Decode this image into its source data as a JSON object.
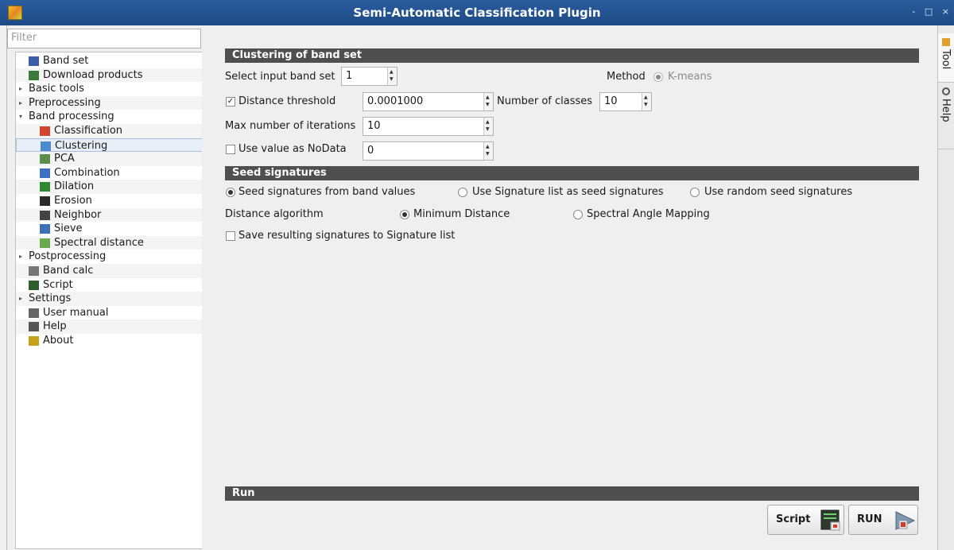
{
  "window": {
    "title": "Semi-Automatic Classification Plugin",
    "controls": "- □ ×"
  },
  "sidebar": {
    "filter_placeholder": "Filter",
    "items": [
      {
        "label": "Band set",
        "level": 0,
        "icon": "band-set-icon",
        "icon_color": "#3a5fa8"
      },
      {
        "label": "Download products",
        "level": 0,
        "icon": "download-icon",
        "icon_color": "#3c7a3a"
      },
      {
        "label": "Basic tools",
        "level": 0,
        "arrow": "▸"
      },
      {
        "label": "Preprocessing",
        "level": 0,
        "arrow": "▸"
      },
      {
        "label": "Band processing",
        "level": 0,
        "arrow": "▾"
      },
      {
        "label": "Classification",
        "level": 1,
        "icon": "classification-icon",
        "icon_color": "#d1442e"
      },
      {
        "label": "Clustering",
        "level": 1,
        "icon": "clustering-icon",
        "icon_color": "#4a8ad0",
        "selected": true
      },
      {
        "label": "PCA",
        "level": 1,
        "icon": "pca-icon",
        "icon_color": "#5a8f4a"
      },
      {
        "label": "Combination",
        "level": 1,
        "icon": "combination-icon",
        "icon_color": "#3e6fc0"
      },
      {
        "label": "Dilation",
        "level": 1,
        "icon": "dilation-icon",
        "icon_color": "#2f8a2f"
      },
      {
        "label": "Erosion",
        "level": 1,
        "icon": "erosion-icon",
        "icon_color": "#2a2a2a"
      },
      {
        "label": "Neighbor",
        "level": 1,
        "icon": "neighbor-icon",
        "icon_color": "#444444"
      },
      {
        "label": "Sieve",
        "level": 1,
        "icon": "sieve-icon",
        "icon_color": "#3d6fb8"
      },
      {
        "label": "Spectral distance",
        "level": 1,
        "icon": "spectral-distance-icon",
        "icon_color": "#6aa84f"
      },
      {
        "label": "Postprocessing",
        "level": 0,
        "arrow": "▸"
      },
      {
        "label": "Band calc",
        "level": 0,
        "icon": "band-calc-icon",
        "icon_color": "#777777"
      },
      {
        "label": "Script",
        "level": 0,
        "icon": "script-icon",
        "icon_color": "#2e5d2e"
      },
      {
        "label": "Settings",
        "level": 0,
        "arrow": "▸"
      },
      {
        "label": "User manual",
        "level": 0,
        "icon": "user-manual-icon",
        "icon_color": "#666666"
      },
      {
        "label": "Help",
        "level": 0,
        "icon": "help-icon",
        "icon_color": "#555555"
      },
      {
        "label": "About",
        "level": 0,
        "icon": "about-icon",
        "icon_color": "#c6a21a"
      }
    ]
  },
  "clustering": {
    "header": "Clustering of band set",
    "input_band_set_label": "Select input band set",
    "input_band_set_value": "1",
    "method_label": "Method",
    "method_option": "K-means",
    "distance_threshold_label": "Distance threshold",
    "distance_threshold_checked": true,
    "distance_threshold_value": "0.0001000",
    "num_classes_label": "Number of classes",
    "num_classes_value": "10",
    "max_iterations_label": "Max number of iterations",
    "max_iterations_value": "10",
    "nodata_label": "Use value as NoData",
    "nodata_checked": false,
    "nodata_value": "0"
  },
  "seed": {
    "header": "Seed signatures",
    "opt_band_values": "Seed signatures from band values",
    "opt_signature_list": "Use Signature list as seed signatures",
    "opt_random": "Use random seed signatures",
    "distance_algorithm_label": "Distance algorithm",
    "opt_min_distance": "Minimum Distance",
    "opt_sam": "Spectral Angle Mapping",
    "save_signatures_label": "Save resulting signatures to Signature list"
  },
  "run": {
    "header": "Run",
    "script_label": "Script",
    "run_label": "RUN"
  },
  "dock": {
    "tab_tool": "Tool",
    "tab_help": "Help"
  },
  "colors": {
    "titlebar": "#245494",
    "section_header": "#4f4f4f",
    "selection": "#e8eef8"
  }
}
